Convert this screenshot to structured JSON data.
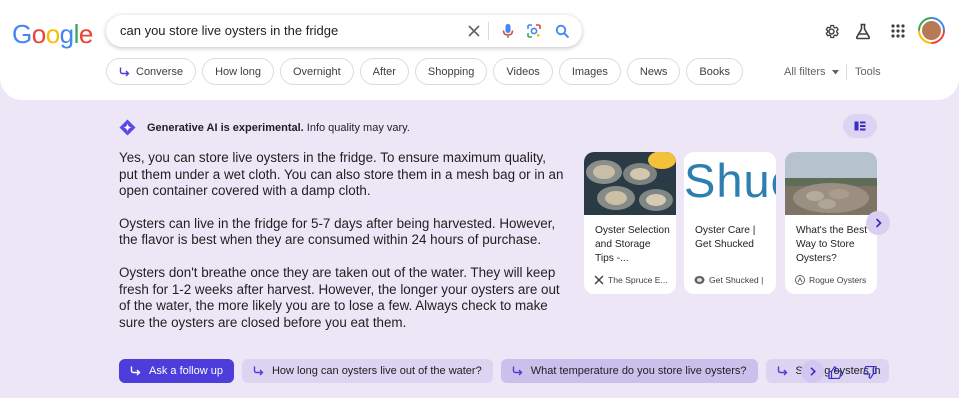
{
  "logo": {
    "text": "Google",
    "letters": [
      "G",
      "o",
      "o",
      "g",
      "l",
      "e"
    ],
    "colors": [
      "#4285f4",
      "#ea4335",
      "#fbbc05",
      "#4285f4",
      "#34a853",
      "#ea4335"
    ]
  },
  "search": {
    "query": "can you store live oysters in the fridge",
    "icons": [
      "close-icon",
      "mic-icon",
      "lens-icon",
      "search-icon"
    ]
  },
  "header_icons": [
    "gear-icon",
    "labs-flask-icon",
    "apps-grid-icon",
    "avatar"
  ],
  "chips": [
    {
      "label": "Converse",
      "icon": "follow-arrow-icon"
    },
    {
      "label": "How long"
    },
    {
      "label": "Overnight"
    },
    {
      "label": "After"
    },
    {
      "label": "Shopping"
    },
    {
      "label": "Videos"
    },
    {
      "label": "Images"
    },
    {
      "label": "News"
    },
    {
      "label": "Books"
    }
  ],
  "all_filters": "All filters",
  "tools": "Tools",
  "sge": {
    "notice_bold": "Generative AI is experimental.",
    "notice_rest": "Info quality may vary.",
    "accent": "#4d3ddb",
    "paragraphs": [
      "Yes, you can store live oysters in the fridge. To ensure maximum quality, put them under a wet cloth. You can also store them in a mesh bag or in an open container covered with a damp cloth.",
      "Oysters can live in the fridge for 5-7 days after being harvested. However, the flavor is best when they are consumed within 24 hours of purchase.",
      "Oysters don't breathe once they are taken out of the water. They will keep fresh for 1-2 weeks after harvest. However, the longer your oysters are out of the water, the more likely you are to lose a few. Always check to make sure the oysters are closed before you eat them."
    ],
    "cards": [
      {
        "title": "Oyster Selection and Storage Tips -...",
        "source": "The Spruce E..."
      },
      {
        "title": "Oyster Care | Get Shucked",
        "source": "Get Shucked |",
        "image_text": "Shuc"
      },
      {
        "title": "What's the Best Way to Store Oysters?",
        "source": "Rogue Oysters"
      }
    ],
    "ask_followup": "Ask a follow up",
    "followups": [
      "How long can oysters live out of the water?",
      "What temperature do you store live oysters?",
      "Storing oysters in"
    ]
  }
}
